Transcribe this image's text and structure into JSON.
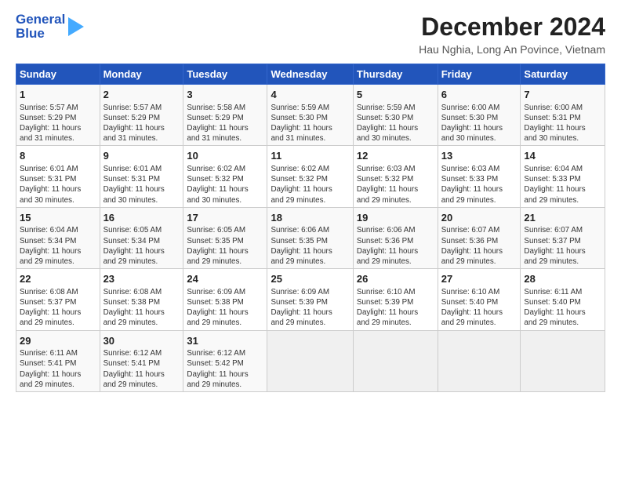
{
  "logo": {
    "line1": "General",
    "line2": "Blue"
  },
  "title": "December 2024",
  "subtitle": "Hau Nghia, Long An Povince, Vietnam",
  "days_of_week": [
    "Sunday",
    "Monday",
    "Tuesday",
    "Wednesday",
    "Thursday",
    "Friday",
    "Saturday"
  ],
  "weeks": [
    [
      {
        "day": "1",
        "info": "Sunrise: 5:57 AM\nSunset: 5:29 PM\nDaylight: 11 hours\nand 31 minutes."
      },
      {
        "day": "2",
        "info": "Sunrise: 5:57 AM\nSunset: 5:29 PM\nDaylight: 11 hours\nand 31 minutes."
      },
      {
        "day": "3",
        "info": "Sunrise: 5:58 AM\nSunset: 5:29 PM\nDaylight: 11 hours\nand 31 minutes."
      },
      {
        "day": "4",
        "info": "Sunrise: 5:59 AM\nSunset: 5:30 PM\nDaylight: 11 hours\nand 31 minutes."
      },
      {
        "day": "5",
        "info": "Sunrise: 5:59 AM\nSunset: 5:30 PM\nDaylight: 11 hours\nand 30 minutes."
      },
      {
        "day": "6",
        "info": "Sunrise: 6:00 AM\nSunset: 5:30 PM\nDaylight: 11 hours\nand 30 minutes."
      },
      {
        "day": "7",
        "info": "Sunrise: 6:00 AM\nSunset: 5:31 PM\nDaylight: 11 hours\nand 30 minutes."
      }
    ],
    [
      {
        "day": "8",
        "info": "Sunrise: 6:01 AM\nSunset: 5:31 PM\nDaylight: 11 hours\nand 30 minutes."
      },
      {
        "day": "9",
        "info": "Sunrise: 6:01 AM\nSunset: 5:31 PM\nDaylight: 11 hours\nand 30 minutes."
      },
      {
        "day": "10",
        "info": "Sunrise: 6:02 AM\nSunset: 5:32 PM\nDaylight: 11 hours\nand 30 minutes."
      },
      {
        "day": "11",
        "info": "Sunrise: 6:02 AM\nSunset: 5:32 PM\nDaylight: 11 hours\nand 29 minutes."
      },
      {
        "day": "12",
        "info": "Sunrise: 6:03 AM\nSunset: 5:32 PM\nDaylight: 11 hours\nand 29 minutes."
      },
      {
        "day": "13",
        "info": "Sunrise: 6:03 AM\nSunset: 5:33 PM\nDaylight: 11 hours\nand 29 minutes."
      },
      {
        "day": "14",
        "info": "Sunrise: 6:04 AM\nSunset: 5:33 PM\nDaylight: 11 hours\nand 29 minutes."
      }
    ],
    [
      {
        "day": "15",
        "info": "Sunrise: 6:04 AM\nSunset: 5:34 PM\nDaylight: 11 hours\nand 29 minutes."
      },
      {
        "day": "16",
        "info": "Sunrise: 6:05 AM\nSunset: 5:34 PM\nDaylight: 11 hours\nand 29 minutes."
      },
      {
        "day": "17",
        "info": "Sunrise: 6:05 AM\nSunset: 5:35 PM\nDaylight: 11 hours\nand 29 minutes."
      },
      {
        "day": "18",
        "info": "Sunrise: 6:06 AM\nSunset: 5:35 PM\nDaylight: 11 hours\nand 29 minutes."
      },
      {
        "day": "19",
        "info": "Sunrise: 6:06 AM\nSunset: 5:36 PM\nDaylight: 11 hours\nand 29 minutes."
      },
      {
        "day": "20",
        "info": "Sunrise: 6:07 AM\nSunset: 5:36 PM\nDaylight: 11 hours\nand 29 minutes."
      },
      {
        "day": "21",
        "info": "Sunrise: 6:07 AM\nSunset: 5:37 PM\nDaylight: 11 hours\nand 29 minutes."
      }
    ],
    [
      {
        "day": "22",
        "info": "Sunrise: 6:08 AM\nSunset: 5:37 PM\nDaylight: 11 hours\nand 29 minutes."
      },
      {
        "day": "23",
        "info": "Sunrise: 6:08 AM\nSunset: 5:38 PM\nDaylight: 11 hours\nand 29 minutes."
      },
      {
        "day": "24",
        "info": "Sunrise: 6:09 AM\nSunset: 5:38 PM\nDaylight: 11 hours\nand 29 minutes."
      },
      {
        "day": "25",
        "info": "Sunrise: 6:09 AM\nSunset: 5:39 PM\nDaylight: 11 hours\nand 29 minutes."
      },
      {
        "day": "26",
        "info": "Sunrise: 6:10 AM\nSunset: 5:39 PM\nDaylight: 11 hours\nand 29 minutes."
      },
      {
        "day": "27",
        "info": "Sunrise: 6:10 AM\nSunset: 5:40 PM\nDaylight: 11 hours\nand 29 minutes."
      },
      {
        "day": "28",
        "info": "Sunrise: 6:11 AM\nSunset: 5:40 PM\nDaylight: 11 hours\nand 29 minutes."
      }
    ],
    [
      {
        "day": "29",
        "info": "Sunrise: 6:11 AM\nSunset: 5:41 PM\nDaylight: 11 hours\nand 29 minutes."
      },
      {
        "day": "30",
        "info": "Sunrise: 6:12 AM\nSunset: 5:41 PM\nDaylight: 11 hours\nand 29 minutes."
      },
      {
        "day": "31",
        "info": "Sunrise: 6:12 AM\nSunset: 5:42 PM\nDaylight: 11 hours\nand 29 minutes."
      },
      {
        "day": "",
        "info": ""
      },
      {
        "day": "",
        "info": ""
      },
      {
        "day": "",
        "info": ""
      },
      {
        "day": "",
        "info": ""
      }
    ]
  ]
}
